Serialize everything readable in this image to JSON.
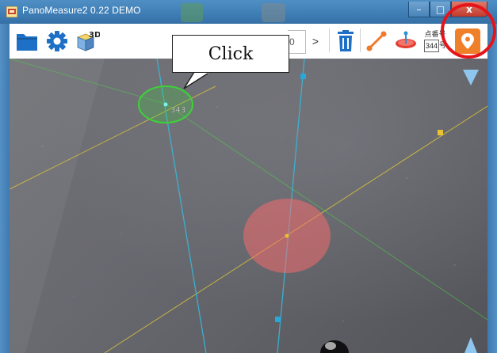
{
  "window": {
    "title": "PanoMeasure2 0.22 DEMO",
    "minimize_glyph": "–",
    "maximize_glyph": "□",
    "close_glyph": "x"
  },
  "toolbar": {
    "open_icon": "folder-icon",
    "settings_icon": "gear-icon",
    "view3d_icon": "cube-3d-icon",
    "view3d_label": "3D",
    "partial_value": "0",
    "next_label": ">",
    "delete_icon": "trash-icon",
    "line_icon": "line-measure-icon",
    "plane_icon": "plane-icon",
    "point_number_label": "点番号",
    "point_number_value": "344",
    "point_number_suffix": "号",
    "add_point_icon": "map-pin-icon"
  },
  "pano": {
    "point_label": "343"
  },
  "annotation": {
    "callout_text": "Click"
  },
  "colors": {
    "title_bar": "#3f7fb6",
    "toolbar_blue": "#1e70c6",
    "pin_orange": "#f07f2a",
    "trash_blue": "#1e70c6",
    "line_orange": "#f07a2a",
    "selected_point_green": "#3dd13a",
    "guide_line_yellow": "#d8c23a",
    "guide_line_cyan": "#38b7d8",
    "target_disc_red": "#ff6b6b",
    "highlight_ring_red": "#e5141a"
  }
}
